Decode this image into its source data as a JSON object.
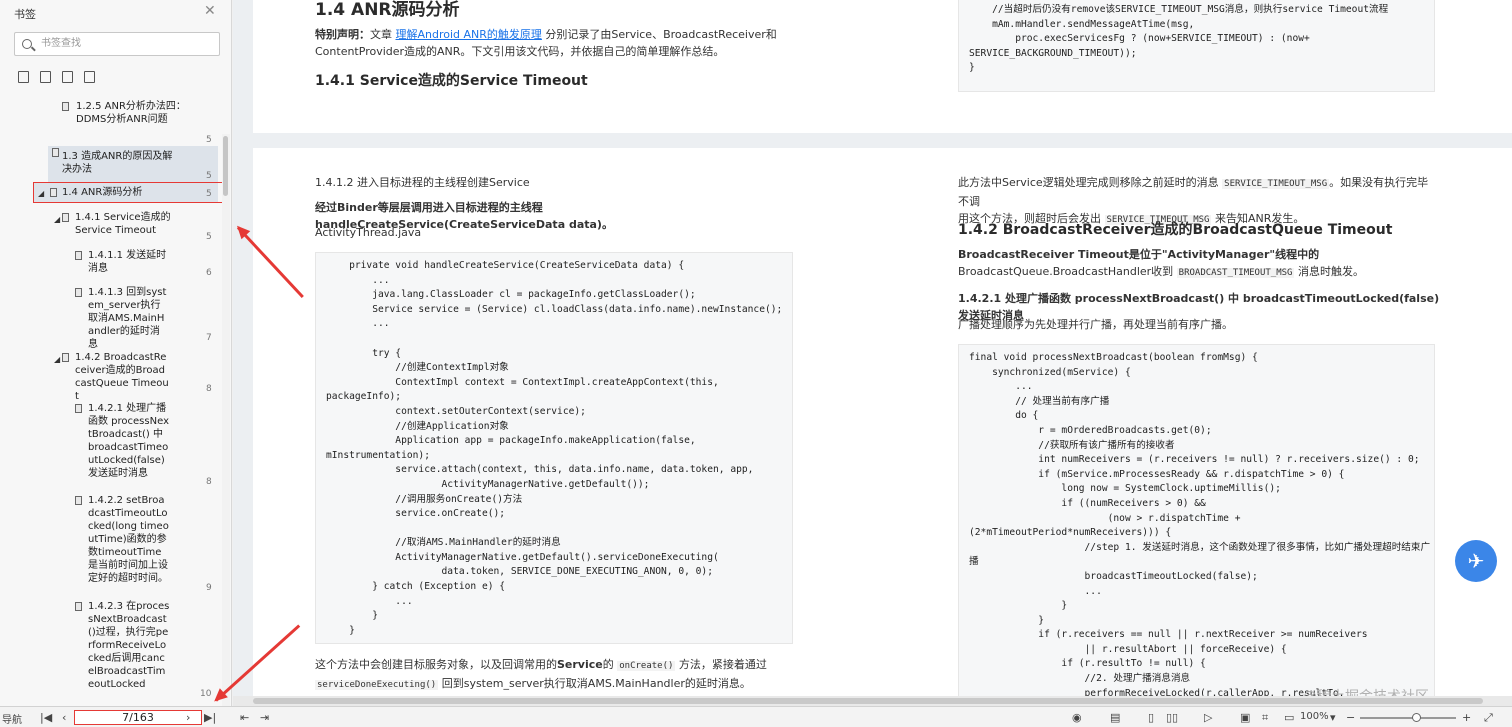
{
  "sidebar": {
    "title": "书签",
    "search_placeholder": "书签查找",
    "items": [
      {
        "label": "1.2.5 ANR分析办法四：DDMS分析ANR问题",
        "page": "5"
      },
      {
        "label": "1.3 造成ANR的原因及解决办法",
        "page": "5"
      },
      {
        "label": "1.4 ANR源码分析",
        "page": "5"
      },
      {
        "label": "1.4.1 Service造成的Service Timeout",
        "page": "5"
      },
      {
        "label": "1.4.1.1 发送延时消息",
        "page": "6"
      },
      {
        "label": "1.4.1.3 回到system_server执行取消AMS.MainHandler的延时消息",
        "page": "7"
      },
      {
        "label": "1.4.2 BroadcastReceiver造成的BroadcastQueue Timeout",
        "page": "8"
      },
      {
        "label": "1.4.2.1 处理广播函数 processNextBroadcast() 中 broadcastTimeoutLocked(false) 发送延时消息",
        "page": "8"
      },
      {
        "label": "1.4.2.2 setBroadcastTimeoutLocked(long timeoutTime)函数的参数timeoutTime是当前时间加上设定好的超时时间。",
        "page": "9"
      },
      {
        "label": "1.4.2.3 在processNextBroadcast()过程，执行完performReceiveLocked后调用cancelBroadcastTimeoutLocked",
        "page": "10"
      }
    ]
  },
  "page1": {
    "heading": "1.4 ANR源码分析",
    "notice_bold": "特别声明：",
    "notice_pre": "文章 ",
    "notice_link": "理解Android ANR的触发原理",
    "notice_post": " 分别记录了由Service、BroadcastReceiver和",
    "notice_line2": "ContentProvider造成的ANR。下文引用该文代码，并依据自己的简单理解作总结。",
    "subheading": "1.4.1 Service造成的Service Timeout",
    "code_right": "    //当超时后仍没有remove该SERVICE_TIMEOUT_MSG消息，则执行service Timeout流程\n    mAm.mHandler.sendMessageAtTime(msg,\n        proc.execServicesFg ? (now+SERVICE_TIMEOUT) : (now+\nSERVICE_BACKGROUND_TIMEOUT));\n}"
  },
  "page2": {
    "left": {
      "sub": "1.4.1.2 进入目标进程的主线程创建Service",
      "bold": "经过Binder等层层调用进入目标进程的主线程 handleCreateService(CreateServiceData data)。",
      "file": "ActivityThread.java",
      "code": "    private void handleCreateService(CreateServiceData data) {\n        ...\n        java.lang.ClassLoader cl = packageInfo.getClassLoader();\n        Service service = (Service) cl.loadClass(data.info.name).newInstance();\n        ...\n\n        try {\n            //创建ContextImpl对象\n            ContextImpl context = ContextImpl.createAppContext(this,\npackageInfo);\n            context.setOuterContext(service);\n            //创建Application对象\n            Application app = packageInfo.makeApplication(false,\nmInstrumentation);\n            service.attach(context, this, data.info.name, data.token, app,\n                    ActivityManagerNative.getDefault());\n            //调用服务onCreate()方法\n            service.onCreate();\n\n            //取消AMS.MainHandler的延时消息\n            ActivityManagerNative.getDefault().serviceDoneExecuting(\n                    data.token, SERVICE_DONE_EXECUTING_ANON, 0, 0);\n        } catch (Exception e) {\n            ...\n        }\n    }",
      "after1_pre": "这个方法中会创建目标服务对象，以及回调常用的",
      "after1_bold": "Service",
      "after1_mid": "的 ",
      "after1_code": "onCreate()",
      "after1_post": " 方法，紧接着通过",
      "after2_code": "serviceDoneExecuting()",
      "after2_post": " 回到system_server执行取消AMS.MainHandler的延时消息。"
    },
    "right": {
      "p1_pre": "此方法中Service逻辑处理完成则移除之前延时的消息 ",
      "p1_code": "SERVICE_TIMEOUT_MSG",
      "p1_post": "。如果没有执行完毕不调",
      "p2_pre": "用这个方法，则超时后会发出 ",
      "p2_code": "SERVICE_TIMEOUT_MSG",
      "p2_post": " 来告知ANR发生。",
      "heading": "1.4.2 BroadcastReceiver造成的BroadcastQueue Timeout",
      "p3_bold": "BroadcastReceiver Timeout是位于\"ActivityManager\"线程中的",
      "p4_pre": "BroadcastQueue.BroadcastHandler收到 ",
      "p4_code": "BROADCAST_TIMEOUT_MSG",
      "p4_post": " 消息时触发。",
      "sub": "1.4.2.1 处理广播函数 processNextBroadcast() 中 broadcastTimeoutLocked(false) 发送延时消息",
      "p5": "广播处理顺序为先处理并行广播，再处理当前有序广播。",
      "code": "final void processNextBroadcast(boolean fromMsg) {\n    synchronized(mService) {\n        ...\n        // 处理当前有序广播\n        do {\n            r = mOrderedBroadcasts.get(0);\n            //获取所有该广播所有的接收者\n            int numReceivers = (r.receivers != null) ? r.receivers.size() : 0;\n            if (mService.mProcessesReady && r.dispatchTime > 0) {\n                long now = SystemClock.uptimeMillis();\n                if ((numReceivers > 0) &&\n                        (now > r.dispatchTime +\n(2*mTimeoutPeriod*numReceivers))) {\n                    //step 1. 发送延时消息，这个函数处理了很多事情，比如广播处理超时结束广\n播\n                    broadcastTimeoutLocked(false);\n                    ...\n                }\n            }\n            if (r.receivers == null || r.nextReceiver >= numReceivers\n                    || r.resultAbort || forceReceive) {\n                if (r.resultTo != null) {\n                    //2. 处理广播消息消息\n                    performReceiveLocked(r.callerApp, r.resultTo,"
    }
  },
  "status": {
    "nav_label": "导航",
    "page_display": "7/163",
    "zoom": "100%"
  },
  "watermark": "@稀土掘金技术社区",
  "colors": {
    "accent": "#e53935",
    "link": "#1a73e8"
  }
}
